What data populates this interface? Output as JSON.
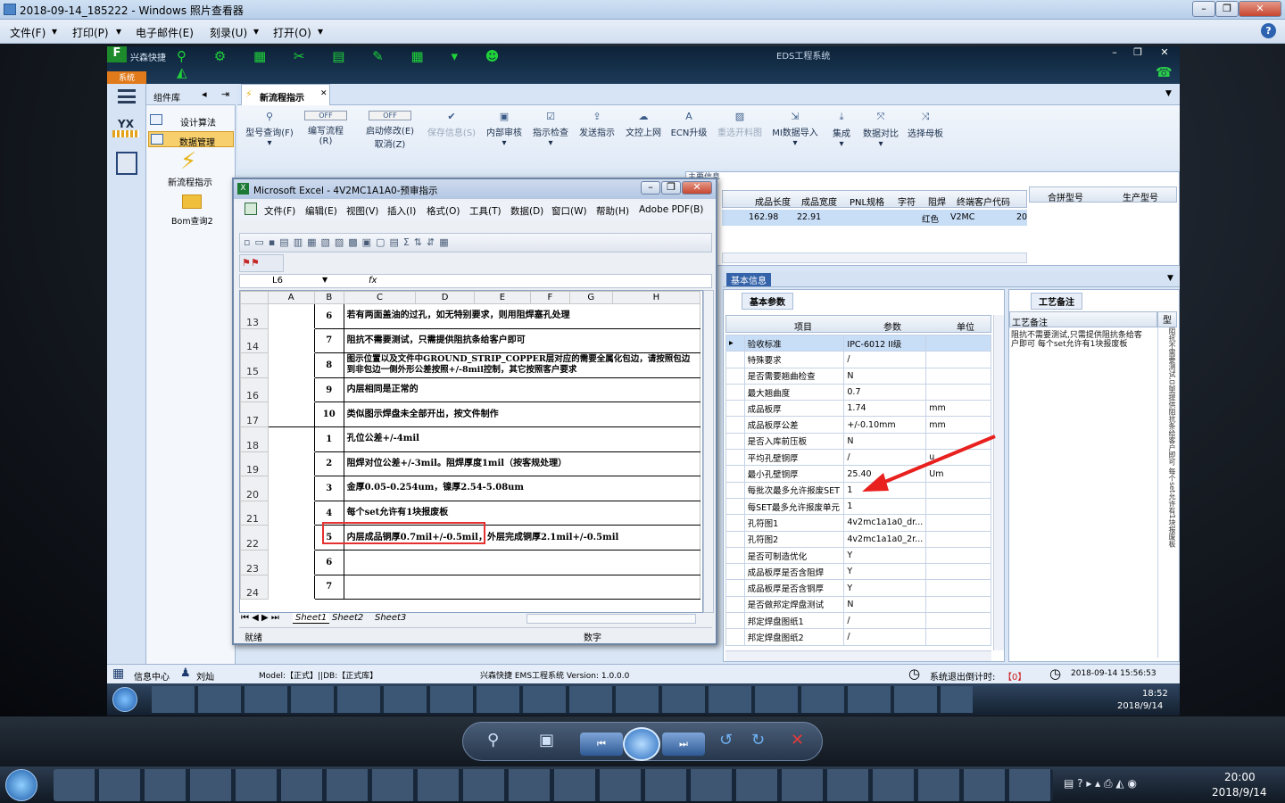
{
  "viewer": {
    "title": "2018-09-14_185222 - Windows 照片查看器",
    "menu": [
      "文件(F)",
      "打印(P)",
      "电子邮件(E)",
      "刻录(U)",
      "打开(O)"
    ]
  },
  "eds": {
    "top_title": "EDS工程系统",
    "brand": "兴森快捷",
    "sys_label": "系统",
    "left_icons": [
      "YX"
    ],
    "nav_header": "组件库",
    "nav_items": [
      "设计算法",
      "数据管理"
    ],
    "nav_big": [
      "新流程指示",
      "Bom查询2"
    ],
    "tab": "新流程指示",
    "ribbon": [
      "型号查询(F)",
      "编写流程(R)",
      "启动修改(E)",
      "保存信息(S)",
      "内部审核",
      "指示检查",
      "发送指示",
      "文控上网",
      "ECN升级",
      "重选开料图",
      "MI数据导入",
      "集成",
      "数据对比",
      "选择母板"
    ],
    "toggle": "OFF",
    "cancel": "取消(Z)",
    "grid_headers": [
      "成品长度",
      "成品宽度",
      "PNL规格",
      "字符",
      "阻焊",
      "终端客户代码"
    ],
    "grid_row": [
      "162.98",
      "22.91",
      "",
      "",
      "红色",
      "V2MC",
      "20"
    ],
    "grid2_headers": [
      "合拼型号",
      "生产型号"
    ],
    "sub_tab_hint": "主要信息",
    "basic_title": "基本信息",
    "basic_tab": "基本参数",
    "param_headers": [
      "项目",
      "参数",
      "单位"
    ],
    "params": [
      [
        "验收标准",
        "IPC-6012 II级",
        ""
      ],
      [
        "特殊要求",
        "/",
        ""
      ],
      [
        "是否需要翘曲检查",
        "N",
        ""
      ],
      [
        "最大翘曲度",
        "0.7",
        ""
      ],
      [
        "成品板厚",
        "1.74",
        "mm"
      ],
      [
        "成品板厚公差",
        "+/-0.10mm",
        "mm"
      ],
      [
        "是否入库前压板",
        "N",
        ""
      ],
      [
        "平均孔壁铜厚",
        "/",
        "u"
      ],
      [
        "最小孔壁铜厚",
        "25.40",
        "Um"
      ],
      [
        "每批次最多允许报废SET",
        "1",
        ""
      ],
      [
        "每SET最多允许报废单元",
        "1",
        ""
      ],
      [
        "孔符图1",
        "4v2mc1a1a0_dr...",
        ""
      ],
      [
        "孔符图2",
        "4v2mc1a1a0_2r...",
        ""
      ],
      [
        "是否可制造优化",
        "Y",
        ""
      ],
      [
        "成品板厚是否含阻焊",
        "Y",
        ""
      ],
      [
        "成品板厚是否含铜厚",
        "Y",
        ""
      ],
      [
        "是否做邦定焊盘测试",
        "N",
        ""
      ],
      [
        "邦定焊盘图纸1",
        "/",
        ""
      ],
      [
        "邦定焊盘图纸2",
        "/",
        ""
      ]
    ],
    "proc_tab": "工艺备注",
    "proc_header": "工艺备注",
    "proc_col": "型",
    "proc_text": "阻抗不需要测试,只需提供阻抗条给客户即可   每个set允许有1块报废板",
    "status_left": [
      "信息中心",
      "刘灿"
    ],
    "status_model": "Model:【正式】||DB:【正式库】",
    "status_center": "兴森快捷  EMS工程系统  Version: 1.0.0.0",
    "status_logout_label": "系统退出倒计时:",
    "status_logout_val": "【0】",
    "status_time": "2018-09-14 15:56:53",
    "inner_clock": {
      "time": "18:52",
      "date": "2018/9/14"
    }
  },
  "excel": {
    "title": "Microsoft Excel - 4V2MC1A1A0-预审指示",
    "menu": [
      "文件(F)",
      "编辑(E)",
      "视图(V)",
      "插入(I)",
      "格式(O)",
      "工具(T)",
      "数据(D)",
      "窗口(W)",
      "帮助(H)",
      "Adobe PDF(B)"
    ],
    "namebox": "L6",
    "fx": "fx",
    "cols": [
      "A",
      "B",
      "C",
      "D",
      "E",
      "F",
      "G",
      "H"
    ],
    "rows": [
      {
        "n": "13",
        "b": "6",
        "c": "若有两面盖油的过孔，如无特别要求，则用阻焊塞孔处理"
      },
      {
        "n": "14",
        "b": "7",
        "c": "阻抗不需要测试，只需提供阻抗条给客户即可"
      },
      {
        "n": "15",
        "b": "8",
        "c": "图示位置以及文件中GROUND_STRIP_COPPER层对应的需要全属化包边，请按照包边到非包边一侧外形公差按照+/-8mil控制，其它按照客户要求"
      },
      {
        "n": "16",
        "b": "9",
        "c": "内层相同是正常的"
      },
      {
        "n": "17",
        "b": "10",
        "c": "类似图示焊盘未全部开出，按文件制作"
      },
      {
        "n": "18",
        "b": "1",
        "c": "孔位公差+/-4mil"
      },
      {
        "n": "19",
        "b": "2",
        "c": "阻焊对位公差+/-3mil。阻焊厚度1mil（按客规处理）"
      },
      {
        "n": "20",
        "b": "3",
        "c": "金厚0.05-0.254um，镍厚2.54-5.08um"
      },
      {
        "n": "21",
        "b": "4",
        "c": "每个set允许有1块报废板"
      },
      {
        "n": "22",
        "b": "5",
        "c": "内层成品铜厚0.7mil+/-0.5mil，外层完成铜厚2.1mil+/-0.5mil"
      },
      {
        "n": "23",
        "b": "6",
        "c": ""
      },
      {
        "n": "24",
        "b": "7",
        "c": ""
      }
    ],
    "sheets": [
      "Sheet1",
      "Sheet2",
      "Sheet3"
    ],
    "status": "就绪",
    "status_num": "数字"
  },
  "clock": {
    "time": "20:00",
    "date": "2018/9/14"
  },
  "colors": {
    "highlight": "#e53030",
    "arrow": "#e8201e",
    "selected_row": "#c8ddf6"
  }
}
